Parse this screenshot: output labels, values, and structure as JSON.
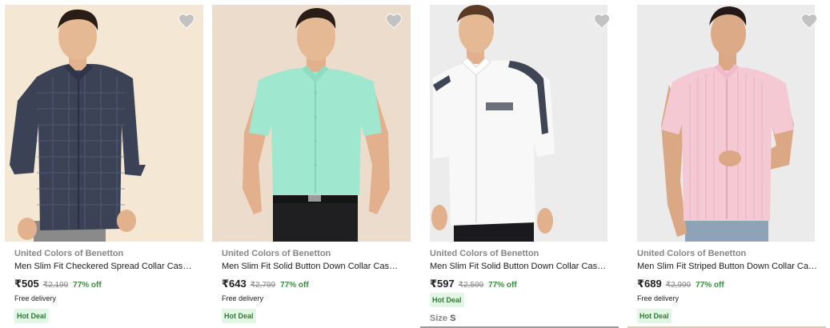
{
  "products": [
    {
      "brand": "United Colors of Benetton",
      "title": "Men Slim Fit Checkered Spread Collar Casual...",
      "price": "₹505",
      "mrp": "₹2,199",
      "discount": "77% off",
      "delivery": "Free delivery",
      "badge": "Hot Deal",
      "bg_color": "#f3e7d3",
      "shirt_color": "#3b4256"
    },
    {
      "brand": "United Colors of Benetton",
      "title": "Men Slim Fit Solid Button Down Collar Casual...",
      "price": "₹643",
      "mrp": "₹2,799",
      "discount": "77% off",
      "delivery": "Free delivery",
      "badge": "Hot Deal",
      "bg_color": "#ecdccb",
      "shirt_color": "#9fe8cf"
    },
    {
      "brand": "United Colors of Benetton",
      "title": "Men Slim Fit Solid Button Down Collar Casual...",
      "price": "₹597",
      "mrp": "₹2,599",
      "discount": "77% off",
      "badge": "Hot Deal",
      "size_label": "Size",
      "size_value": "S",
      "bg_color": "#ececec",
      "shirt_color": "#f7f7f7"
    },
    {
      "brand": "United Colors of Benetton",
      "title": "Men Slim Fit Striped Button Down Collar Casu...",
      "price": "₹689",
      "mrp": "₹2,999",
      "discount": "77% off",
      "delivery": "Free delivery",
      "badge": "Hot Deal",
      "bg_color": "#ebebeb",
      "shirt_color": "#f4c9d4"
    }
  ],
  "icons": {
    "wishlist": "heart-icon"
  },
  "colors": {
    "discount": "#388e3c",
    "badge_bg": "#e3f7e7",
    "heart": "#c2c2c2"
  }
}
